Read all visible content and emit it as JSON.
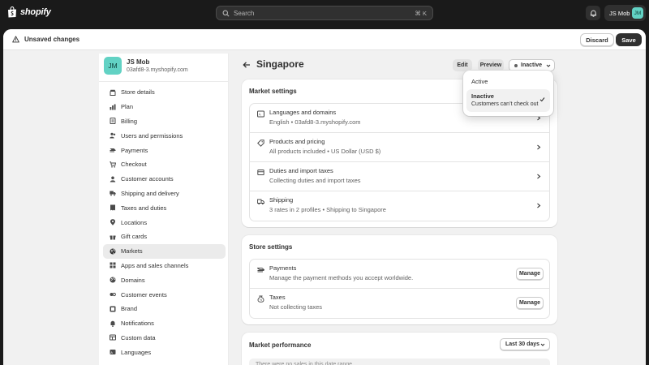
{
  "topbar": {
    "logo_text": "shopify",
    "search_placeholder": "Search",
    "search_shortcut": "⌘ K",
    "account_name": "JS Mob",
    "account_initials": "JM"
  },
  "unsaved_bar": {
    "message": "Unsaved changes",
    "discard_label": "Discard",
    "save_label": "Save"
  },
  "store": {
    "initials": "JM",
    "name": "JS Mob",
    "url": "03afd8-3.myshopify.com"
  },
  "sidebar": {
    "items": [
      {
        "label": "Store details",
        "icon": "store-icon"
      },
      {
        "label": "Plan",
        "icon": "chart-icon"
      },
      {
        "label": "Billing",
        "icon": "billing-icon"
      },
      {
        "label": "Users and permissions",
        "icon": "users-icon"
      },
      {
        "label": "Payments",
        "icon": "payments-icon"
      },
      {
        "label": "Checkout",
        "icon": "cart-icon"
      },
      {
        "label": "Customer accounts",
        "icon": "person-icon"
      },
      {
        "label": "Shipping and delivery",
        "icon": "truck-icon"
      },
      {
        "label": "Taxes and duties",
        "icon": "receipt-icon"
      },
      {
        "label": "Locations",
        "icon": "location-icon"
      },
      {
        "label": "Gift cards",
        "icon": "gift-icon"
      },
      {
        "label": "Markets",
        "icon": "globe-icon"
      },
      {
        "label": "Apps and sales channels",
        "icon": "apps-icon"
      },
      {
        "label": "Domains",
        "icon": "globe-icon"
      },
      {
        "label": "Customer events",
        "icon": "events-icon"
      },
      {
        "label": "Brand",
        "icon": "brand-icon"
      },
      {
        "label": "Notifications",
        "icon": "bell-icon"
      },
      {
        "label": "Custom data",
        "icon": "data-icon"
      },
      {
        "label": "Languages",
        "icon": "language-icon"
      }
    ],
    "active_index": 11
  },
  "page": {
    "title": "Singapore",
    "edit_label": "Edit",
    "preview_label": "Preview",
    "status_label": "Inactive"
  },
  "market_settings": {
    "title": "Market settings",
    "rows": [
      {
        "title": "Languages and domains",
        "subtitle": "English • 03afd8-3.myshopify.com",
        "icon": "language-icon"
      },
      {
        "title": "Products and pricing",
        "subtitle": "All products included • US Dollar (USD $)",
        "icon": "tag-icon"
      },
      {
        "title": "Duties and import taxes",
        "subtitle": "Collecting duties and import taxes",
        "icon": "duties-icon"
      },
      {
        "title": "Shipping",
        "subtitle": "3 rates in 2 profiles • Shipping to Singapore",
        "icon": "truck-icon"
      }
    ]
  },
  "store_settings": {
    "title": "Store settings",
    "rows": [
      {
        "title": "Payments",
        "subtitle": "Manage the payment methods you accept worldwide.",
        "button": "Manage",
        "icon": "payments-icon"
      },
      {
        "title": "Taxes",
        "subtitle": "Not collecting taxes",
        "button": "Manage",
        "icon": "tax-icon"
      }
    ]
  },
  "market_performance": {
    "title": "Market performance",
    "range_label": "Last 30 days",
    "empty_text": "There were no sales in this date range"
  },
  "status_dropdown": {
    "option_active": "Active",
    "option_inactive": "Inactive",
    "option_inactive_desc": "Customers can’t check out"
  }
}
